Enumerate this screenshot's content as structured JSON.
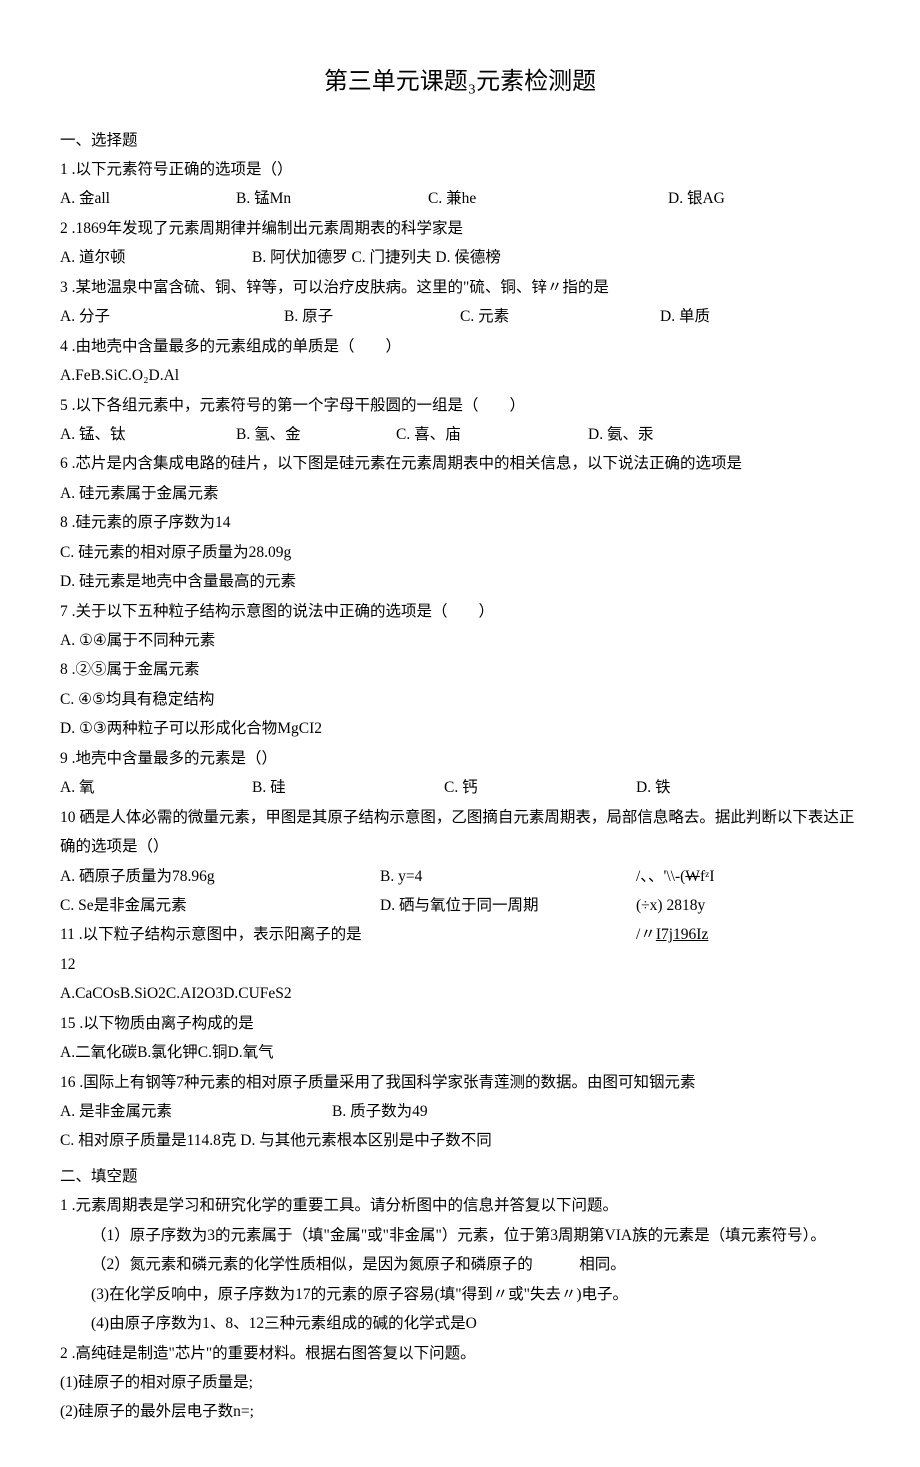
{
  "title": "第三单元课题₃元素检测题",
  "s1_head": "一、选择题",
  "q1": "1 .以下元素符号正确的选项是（）",
  "q1a": "A. 金all",
  "q1b": "B. 锰Mn",
  "q1c": "C. 兼he",
  "q1d": "D. 银AG",
  "q2": "2 .1869年发现了元素周期律并编制出元素周期表的科学家是",
  "q2a": "A. 道尔顿",
  "q2b": "B. 阿伏加德罗 C. 门捷列夫 D. 侯德榜",
  "q3": "3 .某地温泉中富含硫、铜、锌等，可以治疗皮肤病。这里的\"硫、铜、锌〃指的是",
  "q3a": "A. 分子",
  "q3b": "B. 原子",
  "q3c": "C. 元素",
  "q3d": "D. 单质",
  "q4": "4 .由地壳中含量最多的元素组成的单质是（　　）",
  "q4opts": "A.FeB.SiC.O₂D.Al",
  "q5": "5 .以下各组元素中，元素符号的第一个字母干般圆的一组是（　　）",
  "q5a": "A. 锰、钛",
  "q5b": "B. 氢、金",
  "q5c": "C. 喜、庙",
  "q5d": "D. 氨、汞",
  "q6": "6 .芯片是内含集成电路的硅片，以下图是硅元素在元素周期表中的相关信息，以下说法正确的选项是",
  "q6a": "A. 硅元素属于金属元素",
  "q6b": "8 .硅元素的原子序数为14",
  "q6c": "C. 硅元素的相对原子质量为28.09g",
  "q6d": "D. 硅元素是地壳中含量最高的元素",
  "q7": "7 .关于以下五种粒子结构示意图的说法中正确的选项是（　　）",
  "q7a": "A. ①④属于不同种元素",
  "q7b": "8 .②⑤属于金属元素",
  "q7c": "C. ④⑤均具有稳定结构",
  "q7d": "D. ①③两种粒子可以形成化合物MgCI2",
  "q9": "9 .地壳中含量最多的元素是（）",
  "q9a": "A. 氧",
  "q9b": "B. 硅",
  "q9c": "C. 钙",
  "q9d": "D. 铁",
  "q10": "10 硒是人体必需的微量元素，甲图是其原子结构示意图，乙图摘自元素周期表，局部信息略去。据此判断以下表达正确的选项是（）",
  "q10a": "A. 硒原子质量为78.96g",
  "q10b": "B. y=4",
  "q10r1a": "/、、'\\\\-(",
  "q10r1b": "W",
  "q10r1c": "fᶻI",
  "q10c": "C. Se是非金属元素",
  "q10d": "D. 硒与氧位于同一周期",
  "q10r2": "(÷x) 2818y",
  "q11": "11 .以下粒子结构示意图中，表示阳离子的是",
  "q11r": "/〃I7j196Iz",
  "q12": "12",
  "q14opts": "A.CaCOsB.SiO2C.AI2O3D.CUFeS2",
  "q15": "15 .以下物质由离子构成的是",
  "q15opts": "A.二氧化碳B.氯化钾C.铜D.氧气",
  "q16": "16 .国际上有钢等7种元素的相对原子质量采用了我国科学家张青莲测的数据。由图可知铟元素",
  "q16a": "A. 是非金属元素",
  "q16b": "B. 质子数为49",
  "q16c": "C. 相对原子质量是114.8克 D. 与其他元素根本区别是中子数不同",
  "s2_head": "二、填空题",
  "f1": "1 .元素周期表是学习和研究化学的重要工具。请分析图中的信息并答复以下问题。",
  "f1_1": "（1）原子序数为3的元素属于（填\"金属\"或\"非金属\"）元素，位于第3周期第VIA族的元素是（填元素符号）。",
  "f1_2": "（2）氮元素和磷元素的化学性质相似，是因为氮原子和磷原子的　　　相同。",
  "f1_3": "(3)在化学反响中，原子序数为17的元素的原子容易(填\"得到〃或\"失去〃)电子。",
  "f1_4": "(4)由原子序数为1、8、12三种元素组成的碱的化学式是O",
  "f2": "2 .高纯硅是制造\"芯片\"的重要材料。根据右图答复以下问题。",
  "f2_1": "(1)硅原子的相对原子质量是;",
  "f2_2": "(2)硅原子的最外层电子数n=;"
}
